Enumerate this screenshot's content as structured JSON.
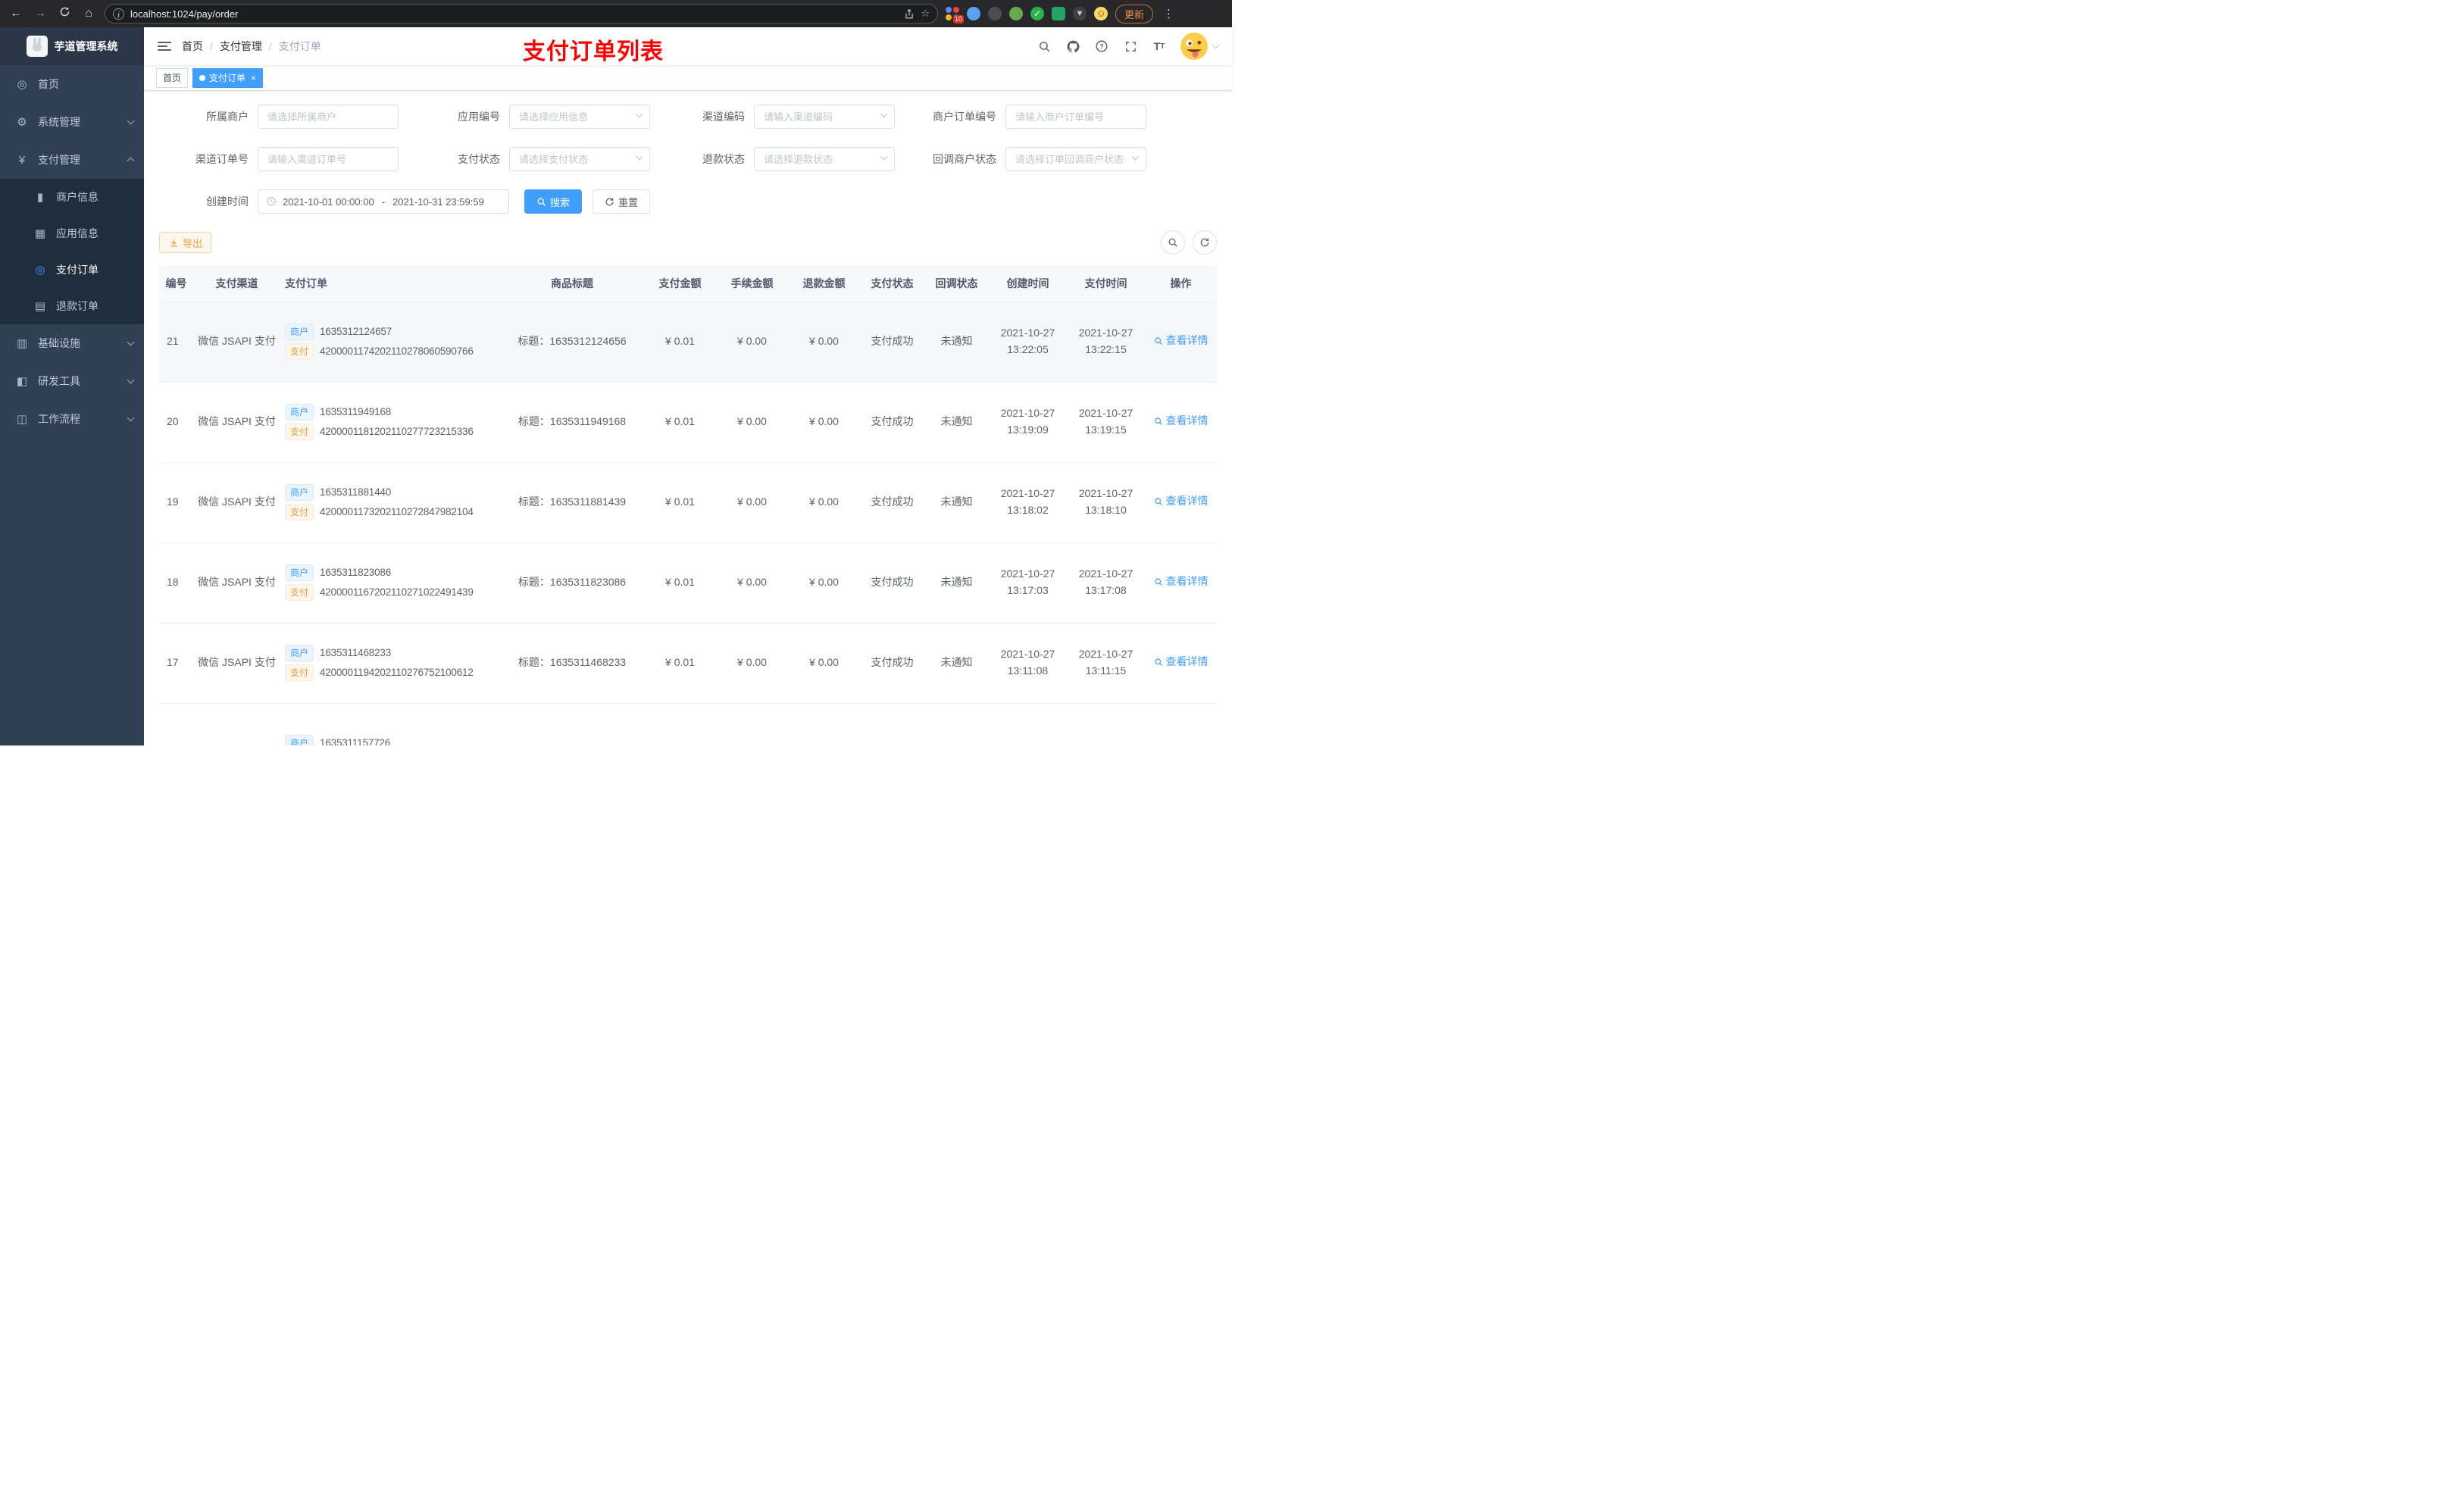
{
  "browser": {
    "url": "localhost:1024/pay/order",
    "update_label": "更新",
    "ext_badge": "10"
  },
  "colors": {
    "primary": "#409eff",
    "sidebar": "#304156",
    "warning": "#e6a23c",
    "annotation_red": "#fe0000"
  },
  "sidebar": {
    "logo_title": "芋道管理系统",
    "items": [
      {
        "label": "首页"
      },
      {
        "label": "系统管理"
      },
      {
        "label": "支付管理"
      },
      {
        "label": "基础设施"
      },
      {
        "label": "研发工具"
      },
      {
        "label": "工作流程"
      }
    ],
    "pay_children": [
      {
        "label": "商户信息"
      },
      {
        "label": "应用信息"
      },
      {
        "label": "支付订单"
      },
      {
        "label": "退款订单"
      }
    ]
  },
  "navbar": {
    "breadcrumb": [
      "首页",
      "支付管理",
      "支付订单"
    ],
    "separator": "/",
    "annotation": "支付订单列表"
  },
  "tabs": [
    {
      "label": "首页"
    },
    {
      "label": "支付订单"
    }
  ],
  "filters": {
    "row1": [
      {
        "label": "所属商户",
        "placeholder": "请选择所属商户"
      },
      {
        "label": "应用编号",
        "placeholder": "请选择应用信息"
      },
      {
        "label": "渠道编码",
        "placeholder": "请输入渠道编码"
      },
      {
        "label": "商户订单编号",
        "placeholder": "请输入商户订单编号"
      }
    ],
    "row2": [
      {
        "label": "渠道订单号",
        "placeholder": "请输入渠道订单号"
      },
      {
        "label": "支付状态",
        "placeholder": "请选择支付状态"
      },
      {
        "label": "退款状态",
        "placeholder": "请选择退款状态"
      },
      {
        "label": "回调商户状态",
        "placeholder": "请选择订单回调商户状态"
      }
    ],
    "date_label": "创建时间",
    "date_start": "2021-10-01 00:00:00",
    "date_separator": "-",
    "date_end": "2021-10-31 23:59:59",
    "search_label": "搜索",
    "reset_label": "重置"
  },
  "toolbar": {
    "export_label": "导出"
  },
  "table": {
    "headers": [
      "编号",
      "支付渠道",
      "支付订单",
      "商品标题",
      "支付金额",
      "手续金额",
      "退款金额",
      "支付状态",
      "回调状态",
      "创建时间",
      "支付时间",
      "操作"
    ],
    "tags": {
      "merchant": "商户",
      "pay": "支付"
    },
    "action_label": "查看详情",
    "rows": [
      {
        "id": "21",
        "channel": "微信 JSAPI 支付",
        "merchant_no": "1635312124657",
        "pay_no": "4200001174202110278060590766",
        "title": "标题：1635312124656",
        "pay_amount": "¥ 0.01",
        "fee_amount": "¥ 0.00",
        "refund_amount": "¥ 0.00",
        "pay_status": "支付成功",
        "notify_status": "未通知",
        "create_time": "2021-10-27 13:22:05",
        "pay_time": "2021-10-27 13:22:15"
      },
      {
        "id": "20",
        "channel": "微信 JSAPI 支付",
        "merchant_no": "1635311949168",
        "pay_no": "4200001181202110277723215336",
        "title": "标题：1635311949168",
        "pay_amount": "¥ 0.01",
        "fee_amount": "¥ 0.00",
        "refund_amount": "¥ 0.00",
        "pay_status": "支付成功",
        "notify_status": "未通知",
        "create_time": "2021-10-27 13:19:09",
        "pay_time": "2021-10-27 13:19:15"
      },
      {
        "id": "19",
        "channel": "微信 JSAPI 支付",
        "merchant_no": "1635311881440",
        "pay_no": "4200001173202110272847982104",
        "title": "标题：1635311881439",
        "pay_amount": "¥ 0.01",
        "fee_amount": "¥ 0.00",
        "refund_amount": "¥ 0.00",
        "pay_status": "支付成功",
        "notify_status": "未通知",
        "create_time": "2021-10-27 13:18:02",
        "pay_time": "2021-10-27 13:18:10"
      },
      {
        "id": "18",
        "channel": "微信 JSAPI 支付",
        "merchant_no": "1635311823086",
        "pay_no": "4200001167202110271022491439",
        "title": "标题：1635311823086",
        "pay_amount": "¥ 0.01",
        "fee_amount": "¥ 0.00",
        "refund_amount": "¥ 0.00",
        "pay_status": "支付成功",
        "notify_status": "未通知",
        "create_time": "2021-10-27 13:17:03",
        "pay_time": "2021-10-27 13:17:08"
      },
      {
        "id": "17",
        "channel": "微信 JSAPI 支付",
        "merchant_no": "1635311468233",
        "pay_no": "4200001194202110276752100612",
        "title": "标题：1635311468233",
        "pay_amount": "¥ 0.01",
        "fee_amount": "¥ 0.00",
        "refund_amount": "¥ 0.00",
        "pay_status": "支付成功",
        "notify_status": "未通知",
        "create_time": "2021-10-27 13:11:08",
        "pay_time": "2021-10-27 13:11:15"
      }
    ],
    "partial_row": {
      "merchant_no": "1635311157726"
    }
  }
}
